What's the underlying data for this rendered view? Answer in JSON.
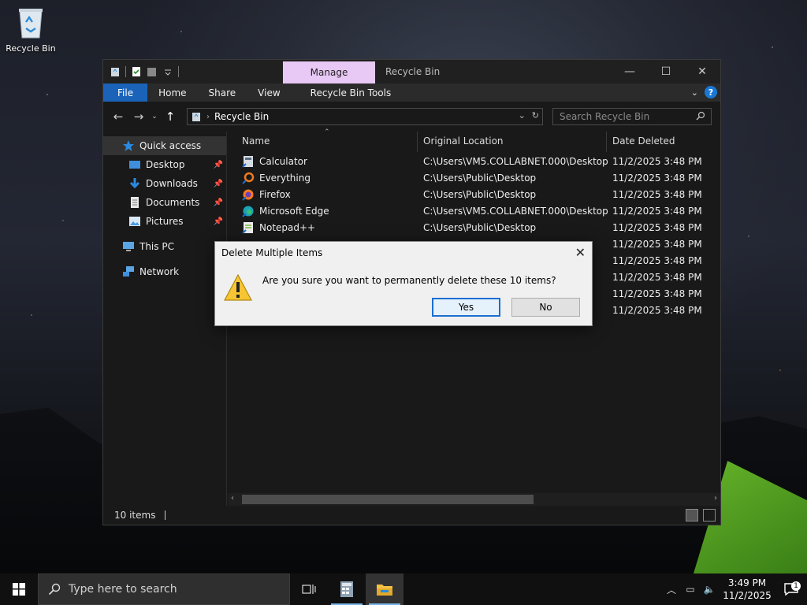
{
  "desktop": {
    "recycle_bin_label": "Recycle Bin"
  },
  "window": {
    "title": "Recycle Bin",
    "context_tab": "Manage",
    "context_color": "#e8c8f4",
    "ribbon_tabs": [
      "File",
      "Home",
      "Share",
      "View",
      "Recycle Bin Tools"
    ],
    "address": "Recycle Bin",
    "search_placeholder": "Search Recycle Bin",
    "status": "10 items"
  },
  "sidebar": {
    "items": [
      {
        "label": "Quick access",
        "icon": "star-icon"
      },
      {
        "label": "Desktop",
        "icon": "desktop-folder-icon",
        "pinned": true
      },
      {
        "label": "Downloads",
        "icon": "download-icon",
        "pinned": true
      },
      {
        "label": "Documents",
        "icon": "document-icon",
        "pinned": true
      },
      {
        "label": "Pictures",
        "icon": "picture-icon",
        "pinned": true
      },
      {
        "label": "This PC",
        "icon": "computer-icon"
      },
      {
        "label": "Network",
        "icon": "network-icon"
      }
    ]
  },
  "table": {
    "columns": [
      "Name",
      "Original Location",
      "Date Deleted"
    ],
    "rows": [
      {
        "name": "Calculator",
        "location": "C:\\Users\\VM5.COLLABNET.000\\Desktop",
        "date": "11/2/2025 3:48 PM"
      },
      {
        "name": "Everything",
        "location": "C:\\Users\\Public\\Desktop",
        "date": "11/2/2025 3:48 PM"
      },
      {
        "name": "Firefox",
        "location": "C:\\Users\\Public\\Desktop",
        "date": "11/2/2025 3:48 PM"
      },
      {
        "name": "Microsoft Edge",
        "location": "C:\\Users\\VM5.COLLABNET.000\\Desktop",
        "date": "11/2/2025 3:48 PM"
      },
      {
        "name": "Notepad++",
        "location": "C:\\Users\\Public\\Desktop",
        "date": "11/2/2025 3:48 PM"
      },
      {
        "name": "",
        "location": "",
        "date": "11/2/2025 3:48 PM"
      },
      {
        "name": "",
        "location": "",
        "date": "11/2/2025 3:48 PM"
      },
      {
        "name": "",
        "location": "",
        "date": "11/2/2025 3:48 PM"
      },
      {
        "name": "",
        "location": "",
        "date": "11/2/2025 3:48 PM"
      },
      {
        "name": "",
        "location": "",
        "date": "11/2/2025 3:48 PM"
      }
    ]
  },
  "dialog": {
    "title": "Delete Multiple Items",
    "message": "Are you sure you want to permanently delete these 10 items?",
    "yes_label": "Yes",
    "no_label": "No"
  },
  "taskbar": {
    "search_placeholder": "Type here to search",
    "time": "3:49 PM",
    "date": "11/2/2025",
    "notification_count": "1"
  }
}
